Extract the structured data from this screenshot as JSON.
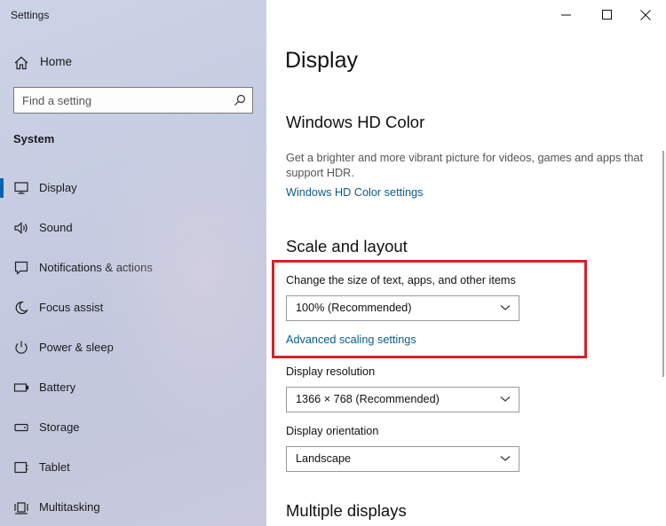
{
  "window": {
    "title": "Settings",
    "controls": {
      "minimize": "minimize-icon",
      "maximize": "maximize-icon",
      "close": "close-icon"
    }
  },
  "sidebar": {
    "home": {
      "label": "Home",
      "icon": "home-icon"
    },
    "search": {
      "placeholder": "Find a setting",
      "icon": "search-icon"
    },
    "section": "System",
    "items": [
      {
        "label": "Display",
        "icon": "monitor-icon",
        "active": true
      },
      {
        "label": "Sound",
        "icon": "speaker-icon",
        "active": false
      },
      {
        "label": "Notifications & actions",
        "icon": "notification-icon",
        "active": false
      },
      {
        "label": "Focus assist",
        "icon": "moon-icon",
        "active": false
      },
      {
        "label": "Power & sleep",
        "icon": "power-icon",
        "active": false
      },
      {
        "label": "Battery",
        "icon": "battery-icon",
        "active": false
      },
      {
        "label": "Storage",
        "icon": "storage-icon",
        "active": false
      },
      {
        "label": "Tablet",
        "icon": "tablet-icon",
        "active": false
      },
      {
        "label": "Multitasking",
        "icon": "multitasking-icon",
        "active": false
      }
    ]
  },
  "main": {
    "title": "Display",
    "hdr": {
      "heading": "Windows HD Color",
      "description": "Get a brighter and more vibrant picture for videos, games and apps that support HDR.",
      "link": "Windows HD Color settings"
    },
    "scale": {
      "heading": "Scale and layout",
      "size_label": "Change the size of text, apps, and other items",
      "size_value": "100% (Recommended)",
      "advanced_link": "Advanced scaling settings",
      "resolution_label": "Display resolution",
      "resolution_value": "1366 × 768 (Recommended)",
      "orientation_label": "Display orientation",
      "orientation_value": "Landscape"
    },
    "multiple": {
      "heading": "Multiple displays"
    }
  },
  "colors": {
    "accent": "#0063b1",
    "link": "#0a5c8a",
    "highlight_box": "#d2232a"
  }
}
